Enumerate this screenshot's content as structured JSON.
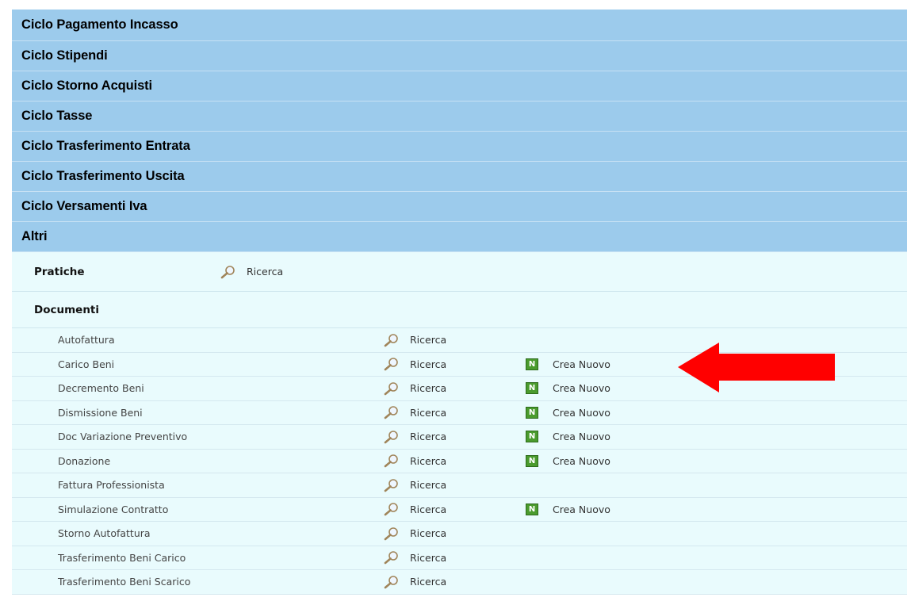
{
  "categories": [
    "Ciclo Pagamento Incasso",
    "Ciclo Stipendi",
    "Ciclo Storno Acquisti",
    "Ciclo Tasse",
    "Ciclo Trasferimento Entrata",
    "Ciclo Trasferimento Uscita",
    "Ciclo Versamenti Iva",
    "Altri"
  ],
  "pratiche": {
    "title": "Pratiche",
    "search_label": "Ricerca"
  },
  "documenti": {
    "title": "Documenti",
    "search_label": "Ricerca",
    "new_label": "Crea Nuovo",
    "rows": [
      {
        "name": "Autofattura",
        "has_new": false
      },
      {
        "name": "Carico Beni",
        "has_new": true
      },
      {
        "name": "Decremento Beni",
        "has_new": true
      },
      {
        "name": "Dismissione Beni",
        "has_new": true
      },
      {
        "name": "Doc Variazione Preventivo",
        "has_new": true
      },
      {
        "name": "Donazione",
        "has_new": true
      },
      {
        "name": "Fattura Professionista",
        "has_new": false
      },
      {
        "name": "Simulazione Contratto",
        "has_new": true
      },
      {
        "name": "Storno Autofattura",
        "has_new": false
      },
      {
        "name": "Trasferimento Beni Carico",
        "has_new": false
      },
      {
        "name": "Trasferimento Beni Scarico",
        "has_new": false
      }
    ]
  },
  "colors": {
    "header_bg": "#9ccbec",
    "content_bg": "#e9fbfd",
    "arrow": "#ff0000",
    "new_icon": "#4a9b2e"
  },
  "icons": {
    "search": "magnifier-icon",
    "new": "new-document-icon",
    "annotation": "red-arrow"
  }
}
